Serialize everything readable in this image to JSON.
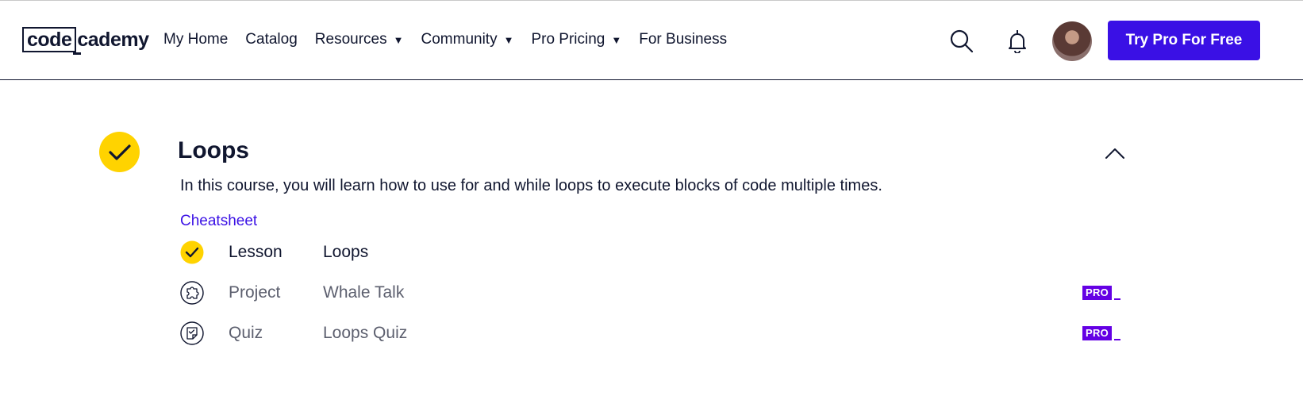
{
  "header": {
    "logo": {
      "left": "code",
      "right": "cademy"
    },
    "nav": [
      {
        "label": "My Home",
        "dropdown": false
      },
      {
        "label": "Catalog",
        "dropdown": false
      },
      {
        "label": "Resources",
        "dropdown": true
      },
      {
        "label": "Community",
        "dropdown": true
      },
      {
        "label": "Pro Pricing",
        "dropdown": true
      },
      {
        "label": "For Business",
        "dropdown": false
      }
    ],
    "caret_glyph": "▼",
    "icons": [
      "search-icon",
      "bell-icon",
      "avatar"
    ],
    "cta_label": "Try Pro For Free"
  },
  "module": {
    "title": "Loops",
    "completed": true,
    "description": "In this course, you will learn how to use for and while loops to execute blocks of code multiple times.",
    "cheatsheet_label": "Cheatsheet",
    "items": [
      {
        "type": "Lesson",
        "name": "Loops",
        "icon": "check-icon",
        "completed": true,
        "pro": false
      },
      {
        "type": "Project",
        "name": "Whale Talk",
        "icon": "puzzle-icon",
        "completed": false,
        "pro": true
      },
      {
        "type": "Quiz",
        "name": "Loops Quiz",
        "icon": "quiz-note-icon",
        "completed": false,
        "pro": true
      }
    ],
    "pro_label": "PRO"
  },
  "colors": {
    "brand": "#3a10e5",
    "pro": "#6400e4",
    "complete": "#ffd300",
    "text": "#10162f"
  }
}
